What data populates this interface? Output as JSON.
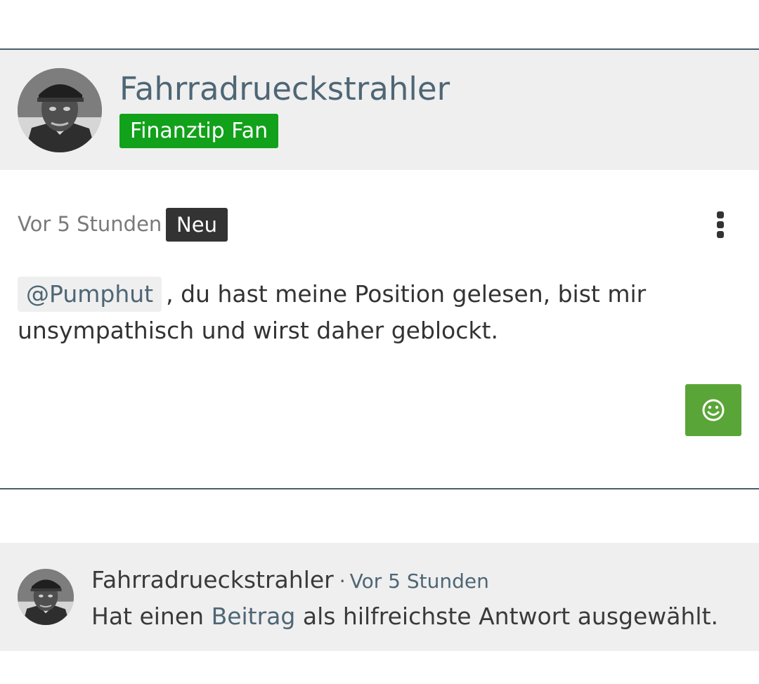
{
  "post": {
    "author": "Fahrradrueckstrahler",
    "rank": "Finanztip Fan",
    "time": "Vor 5 Stunden",
    "new_badge": "Neu",
    "mention": "@Pumphut",
    "text_line1": ", du hast meine Position gelesen, bist mir",
    "text_line2": "unsympathisch und wirst daher geblockt.",
    "react_icon": "smiley-icon",
    "menu_icon": "more-vertical-icon"
  },
  "activity": {
    "author": "Fahrradrueckstrahler",
    "separator": "·",
    "time": "Vor 5 Stunden",
    "text_before": "Hat einen ",
    "link": "Beitrag",
    "text_after": " als hilfreichste Antwort ausgewählt."
  },
  "colors": {
    "accent": "#4e6675",
    "rank_badge": "#11a11a",
    "react_button": "#5aa537",
    "header_bg": "#efefef"
  }
}
